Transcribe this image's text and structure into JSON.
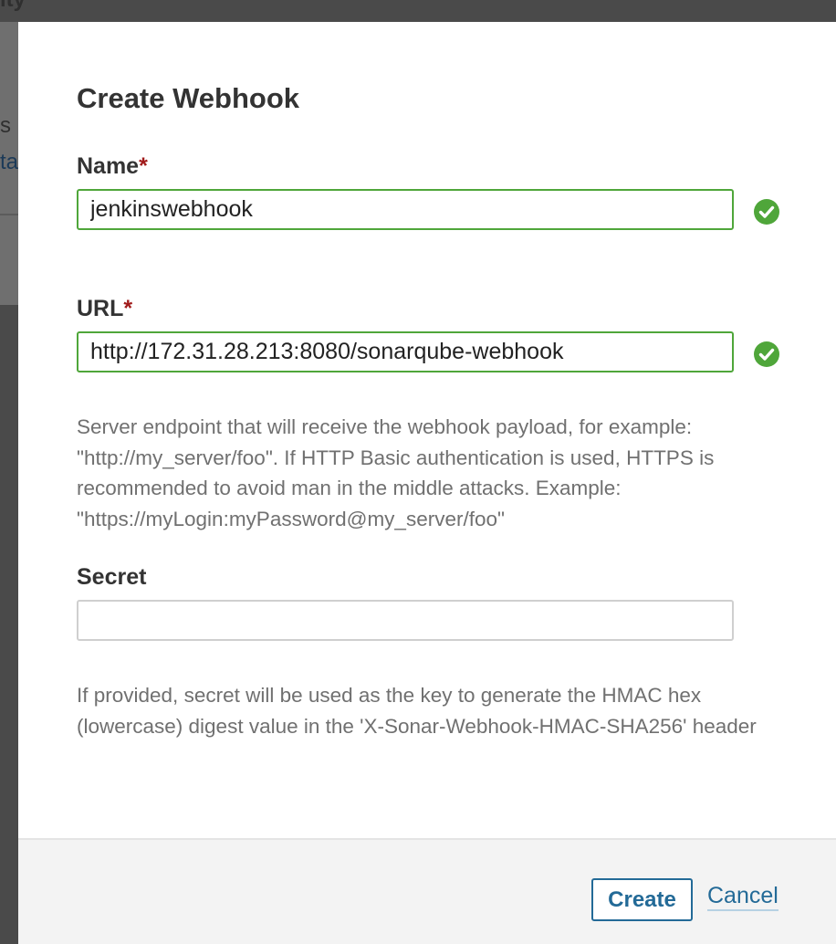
{
  "background": {
    "top_fragment": "ity",
    "fragment_1": "s is",
    "fragment_2": "tat"
  },
  "modal": {
    "title": "Create Webhook",
    "name": {
      "label": "Name",
      "required_mark": "*",
      "value": "jenkinswebhook",
      "valid": true
    },
    "url": {
      "label": "URL",
      "required_mark": "*",
      "value": "http://172.31.28.213:8080/sonarqube-webhook",
      "valid": true,
      "help": "Server endpoint that will receive the webhook payload, for example: \"http://my_server/foo\". If HTTP Basic authentication is used, HTTPS is recommended to avoid man in the middle attacks. Example: \"https://myLogin:myPassword@my_server/foo\""
    },
    "secret": {
      "label": "Secret",
      "value": "",
      "placeholder": "",
      "help": "If provided, secret will be used as the key to generate the HMAC hex (lowercase) digest value in the 'X-Sonar-Webhook-HMAC-SHA256' header"
    },
    "footer": {
      "create_label": "Create",
      "cancel_label": "Cancel"
    }
  },
  "colors": {
    "valid_green": "#4fa63a",
    "link_blue": "#236a97",
    "required_red": "#a11b1b"
  },
  "icons": {
    "valid": "check-circle-icon"
  }
}
